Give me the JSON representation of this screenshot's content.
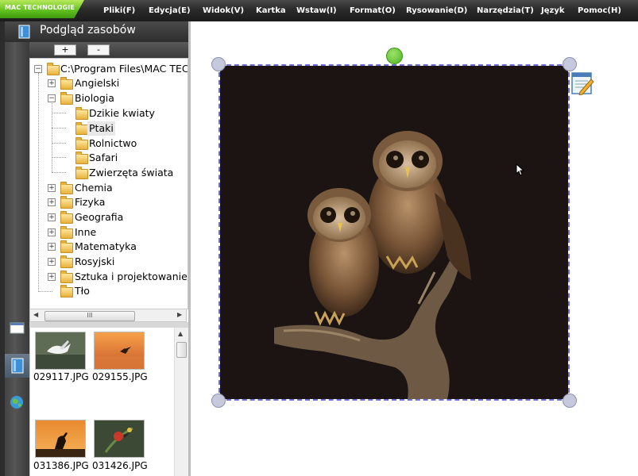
{
  "menubar": {
    "brand": "MAC TECHNOLOGIE",
    "items": [
      "Pliki(F)",
      "Edycja(E)",
      "Widok(V)",
      "Kartka",
      "Wstaw(I)",
      "Format(O)",
      "Rysowanie(D)",
      "Narzędzia(T)",
      "Język",
      "Pomoc(H)"
    ]
  },
  "panel": {
    "title": "Podgląd zasobów",
    "add_label": "+",
    "remove_label": "-",
    "tree": {
      "root": "C:\\Program Files\\MAC TECH",
      "items": [
        {
          "label": "Angielski"
        },
        {
          "label": "Biologia"
        },
        {
          "label": "Dzikie kwiaty"
        },
        {
          "label": "Ptaki"
        },
        {
          "label": "Rolnictwo"
        },
        {
          "label": "Safari"
        },
        {
          "label": "Zwierzęta świata"
        },
        {
          "label": "Chemia"
        },
        {
          "label": "Fizyka"
        },
        {
          "label": "Geografia"
        },
        {
          "label": "Inne"
        },
        {
          "label": "Matematyka"
        },
        {
          "label": "Rosyjski"
        },
        {
          "label": "Sztuka i projektowanie"
        },
        {
          "label": "Tło"
        }
      ],
      "selected": "Ptaki"
    },
    "scroll_thumb_label": "III",
    "thumbnails": [
      {
        "filename": "029117.JPG"
      },
      {
        "filename": "029155.JPG"
      },
      {
        "filename": "031386.JPG"
      },
      {
        "filename": "031426.JPG"
      }
    ]
  },
  "colors": {
    "menubar": "#2a2a2a",
    "brand": "#5fbf1e",
    "selection_border": "#6b6bd6",
    "rotate_handle": "#4cb520",
    "photo_background": "#1b1412"
  },
  "icons": {
    "strip": [
      "page-icon",
      "resource-book-icon",
      "globe-icon"
    ],
    "panel": "resource-book-icon",
    "object_tool": "edit-notepad-icon"
  }
}
